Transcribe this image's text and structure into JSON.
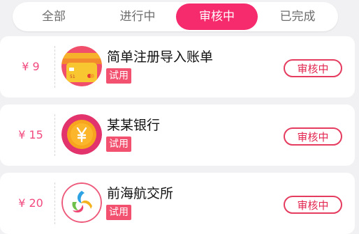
{
  "tabs": [
    {
      "label": "全部",
      "active": false
    },
    {
      "label": "进行中",
      "active": false
    },
    {
      "label": "审核中",
      "active": true
    },
    {
      "label": "已完成",
      "active": false
    }
  ],
  "items": [
    {
      "price": "¥ 9",
      "name": "简单注册导入账单",
      "tag": "试用",
      "status": "审核中",
      "logo": "card-app-icon"
    },
    {
      "price": "¥ 15",
      "name": "某某银行",
      "tag": "试用",
      "status": "审核中",
      "logo": "yen-coin-icon"
    },
    {
      "price": "¥ 20",
      "name": "前海航交所",
      "tag": "试用",
      "status": "审核中",
      "logo": "swirl-logo-icon"
    }
  ],
  "colors": {
    "accent": "#f52b6e",
    "price": "#f24a7f",
    "tag_bg": "#f2516f",
    "status_border": "#e53b5f",
    "background": "#f1f1f3"
  }
}
